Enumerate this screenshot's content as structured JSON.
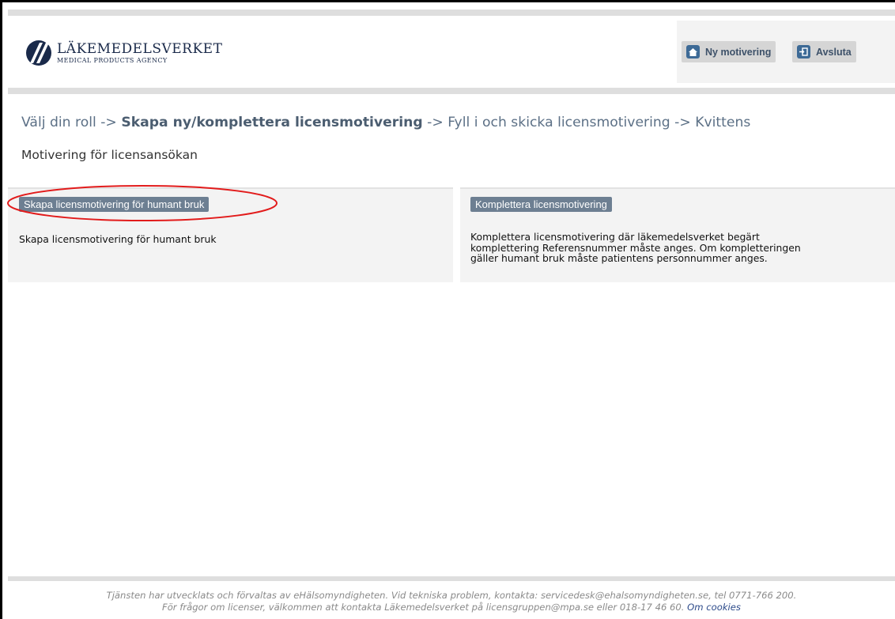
{
  "header": {
    "logo_name": "LÄKEMEDELSVERKET",
    "logo_subtitle": "MEDICAL PRODUCTS AGENCY",
    "buttons": {
      "new_label": "Ny motivering",
      "new_icon": "home-icon",
      "exit_label": "Avsluta",
      "exit_icon": "logout-icon"
    }
  },
  "breadcrumb": {
    "step1": "Välj din roll",
    "step2": "Skapa ny/komplettera licensmotivering",
    "step3": "Fyll i och skicka licensmotivering",
    "step4": "Kvittens",
    "separator": "->"
  },
  "page_title": "Motivering för licensansökan",
  "panels": {
    "create": {
      "button_label": "Skapa licensmotivering för humant bruk",
      "description": "Skapa licensmotivering för humant bruk"
    },
    "complete": {
      "button_label": "Komplettera licensmotivering",
      "description_lines": [
        "Komplettera licensmotivering där läkemedelsverket begärt",
        "komplettering Referensnummer måste anges. Om kompletteringen",
        "gäller humant bruk måste patientens personnummer anges."
      ]
    }
  },
  "footer": {
    "line1": "Tjänsten har utvecklats och förvaltas av eHälsomyndigheten. Vid tekniska problem, kontakta: servicedesk@ehalsomyndigheten.se, tel 0771-766 200.",
    "line2": "För frågor om licenser, välkommen att kontakta Läkemedelsverket på licensgruppen@mpa.se eller 018-17 46 60.",
    "cookies_link": "Om cookies"
  },
  "colors": {
    "brand_navy": "#1a2a4a",
    "button_bg": "#6d7f92",
    "icon_blue": "#3d6a96",
    "annotation_red": "#e21b1b"
  }
}
